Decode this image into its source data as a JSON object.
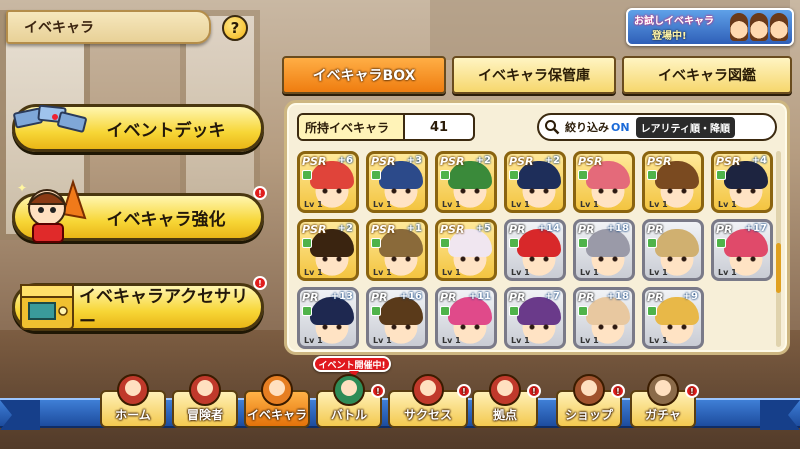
{
  "header": {
    "title": "イベキャラ",
    "help_label": "?"
  },
  "trial_banner": {
    "line1": "お試しイベキャラ",
    "line2": "登場中!"
  },
  "tabs": [
    {
      "label": "イベキャラBOX",
      "active": true
    },
    {
      "label": "イベキャラ保管庫",
      "active": false
    },
    {
      "label": "イベキャラ図鑑",
      "active": false
    }
  ],
  "menu": {
    "event_deck": "イベントデッキ",
    "enhance": "イベキャラ強化",
    "accessory": "イベキャラアクセサリー",
    "notice": "!"
  },
  "owned": {
    "label": "所持イベキャラ",
    "count": "41"
  },
  "filter": {
    "label": "絞り込み",
    "state": "ON",
    "sort": "レアリティ順・降順"
  },
  "cards": [
    {
      "rarity": "PSR",
      "plus": "+6",
      "lv": "Lv 1",
      "hair": "#e0443a",
      "tier": "gold"
    },
    {
      "rarity": "PSR",
      "plus": "+3",
      "lv": "Lv 1",
      "hair": "#2c4a8a",
      "tier": "gold"
    },
    {
      "rarity": "PSR",
      "plus": "+2",
      "lv": "Lv 1",
      "hair": "#3a8a3a",
      "tier": "gold"
    },
    {
      "rarity": "PSR",
      "plus": "+2",
      "lv": "Lv 1",
      "hair": "#1e2e5a",
      "tier": "gold"
    },
    {
      "rarity": "PSR",
      "plus": "",
      "lv": "Lv 1",
      "hair": "#e46a7a",
      "tier": "gold"
    },
    {
      "rarity": "PSR",
      "plus": "",
      "lv": "Lv 1",
      "hair": "#7a4a20",
      "tier": "gold"
    },
    {
      "rarity": "PSR",
      "plus": "+4",
      "lv": "Lv 1",
      "hair": "#1d2440",
      "tier": "gold"
    },
    {
      "rarity": "PSR",
      "plus": "+2",
      "lv": "Lv 1",
      "hair": "#3a2410",
      "tier": "gold"
    },
    {
      "rarity": "PSR",
      "plus": "+1",
      "lv": "Lv 1",
      "hair": "#8a6a3a",
      "tier": "gold"
    },
    {
      "rarity": "PSR",
      "plus": "+5",
      "lv": "Lv 1",
      "hair": "#f0e6f0",
      "tier": "gold"
    },
    {
      "rarity": "PR",
      "plus": "+14",
      "lv": "Lv 1",
      "hair": "#d8282a",
      "tier": "silver"
    },
    {
      "rarity": "PR",
      "plus": "+18",
      "lv": "Lv 1",
      "hair": "#9a9aa8",
      "tier": "silver"
    },
    {
      "rarity": "PR",
      "plus": "",
      "lv": "Lv 1",
      "hair": "#d0b070",
      "tier": "silver"
    },
    {
      "rarity": "PR",
      "plus": "+17",
      "lv": "Lv 1",
      "hair": "#e04a6a",
      "tier": "silver"
    },
    {
      "rarity": "PR",
      "plus": "+13",
      "lv": "Lv 1",
      "hair": "#1e2850",
      "tier": "silver"
    },
    {
      "rarity": "PR",
      "plus": "+16",
      "lv": "Lv 1",
      "hair": "#5a3a1a",
      "tier": "silver"
    },
    {
      "rarity": "PR",
      "plus": "+11",
      "lv": "Lv 1",
      "hair": "#e04a8a",
      "tier": "silver"
    },
    {
      "rarity": "PR",
      "plus": "+7",
      "lv": "Lv 1",
      "hair": "#6a3a8a",
      "tier": "silver"
    },
    {
      "rarity": "PR",
      "plus": "+18",
      "lv": "Lv 1",
      "hair": "#e8c8a0",
      "tier": "silver"
    },
    {
      "rarity": "PR",
      "plus": "+9",
      "lv": "Lv 1",
      "hair": "#e8b848",
      "tier": "silver"
    }
  ],
  "nav": {
    "event_badge": "イベント開催中!",
    "items": [
      {
        "label": "ホーム",
        "notice": ""
      },
      {
        "label": "冒険者",
        "notice": ""
      },
      {
        "label": "イベキャラ",
        "notice": ""
      },
      {
        "label": "バトル",
        "notice": "!"
      },
      {
        "label": "サクセス",
        "notice": "!"
      },
      {
        "label": "拠点",
        "notice": "!"
      },
      {
        "label": "ショップ",
        "notice": "!"
      },
      {
        "label": "ガチャ",
        "notice": "!"
      }
    ]
  }
}
